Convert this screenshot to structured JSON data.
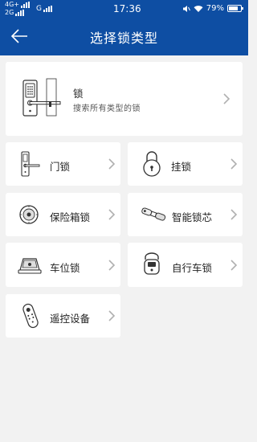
{
  "status_bar": {
    "network1": "4G+",
    "network2": "2G",
    "network3": "G",
    "time": "17:36",
    "battery": "79%",
    "battery_level": 0.79
  },
  "header": {
    "title": "选择锁类型"
  },
  "main_card": {
    "label": "锁",
    "subtitle": "搜索所有类型的锁"
  },
  "items": [
    {
      "label": "门锁"
    },
    {
      "label": "挂锁"
    },
    {
      "label": "保险箱锁"
    },
    {
      "label": "智能锁芯"
    },
    {
      "label": "车位锁"
    },
    {
      "label": "自行车锁"
    },
    {
      "label": "遥控设备"
    }
  ],
  "colors": {
    "header": "#0e4ea3",
    "background": "#f2f2f2",
    "card": "#ffffff",
    "chevron": "#b0b0b0"
  }
}
